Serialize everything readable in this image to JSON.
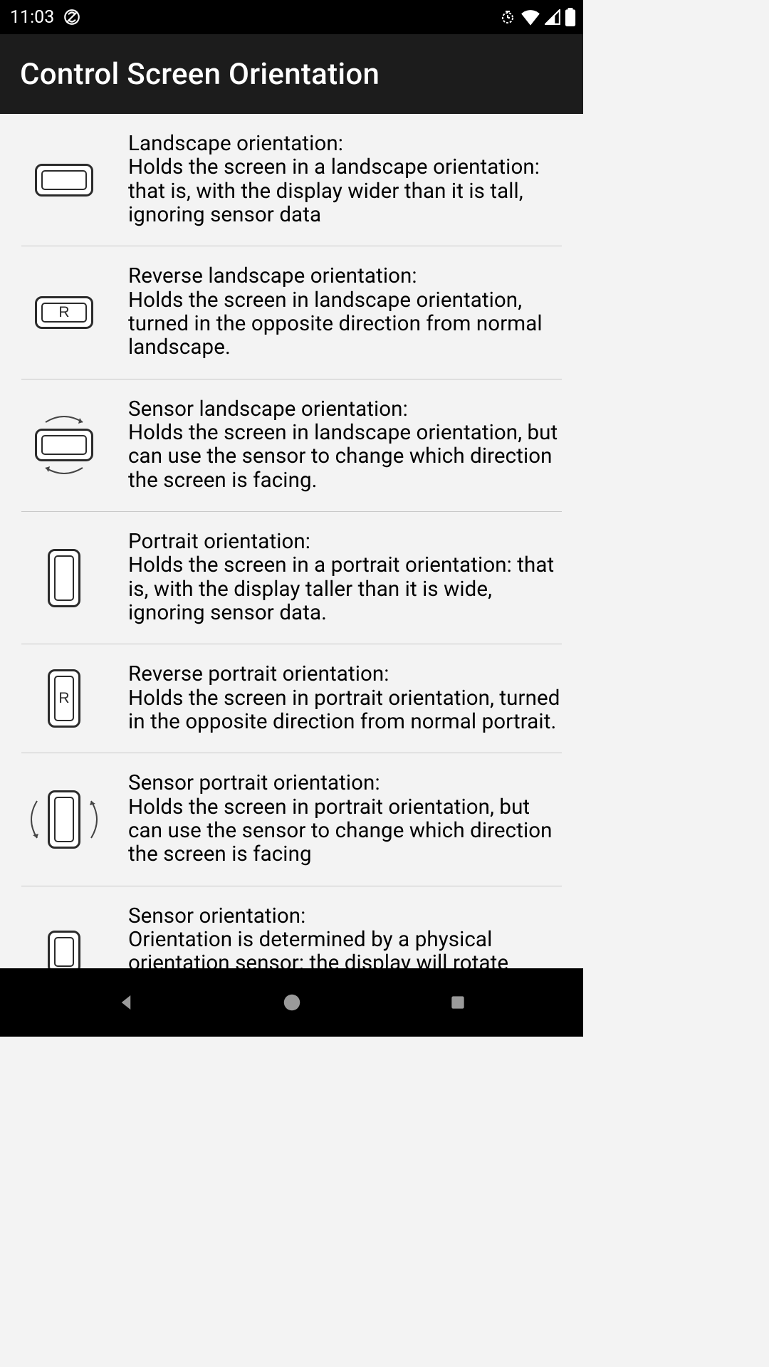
{
  "status_bar": {
    "time": "11:03"
  },
  "header": {
    "title": "Control Screen Orientation"
  },
  "options": [
    {
      "icon": "landscape",
      "title": "Landscape orientation:",
      "desc": "Holds the screen in a landscape orientation: that is, with the display wider than it is tall, ignoring sensor data"
    },
    {
      "icon": "reverse-landscape",
      "title": "Reverse landscape orientation:",
      "desc": "Holds the screen in landscape orientation, turned in the opposite direction from normal landscape."
    },
    {
      "icon": "sensor-landscape",
      "title": "Sensor landscape orientation:",
      "desc": "Holds the screen in landscape orientation, but can use the sensor to change which direction the screen is facing."
    },
    {
      "icon": "portrait",
      "title": "Portrait orientation:",
      "desc": "Holds the screen in a portrait orientation: that is, with the display taller than it is wide, ignoring sensor data."
    },
    {
      "icon": "reverse-portrait",
      "title": "Reverse portrait orientation:",
      "desc": "Holds the screen in portrait orientation, turned in the opposite direction from normal portrait."
    },
    {
      "icon": "sensor-portrait",
      "title": "Sensor portrait orientation:",
      "desc": "Holds the screen in portrait orientation, but can use the sensor to change which direction the screen is facing"
    },
    {
      "icon": "full-sensor",
      "title": "Sensor orientation:",
      "desc": "Orientation is determined by a physical orientation sensor: the display will rotate based on how the user moves the device."
    }
  ]
}
